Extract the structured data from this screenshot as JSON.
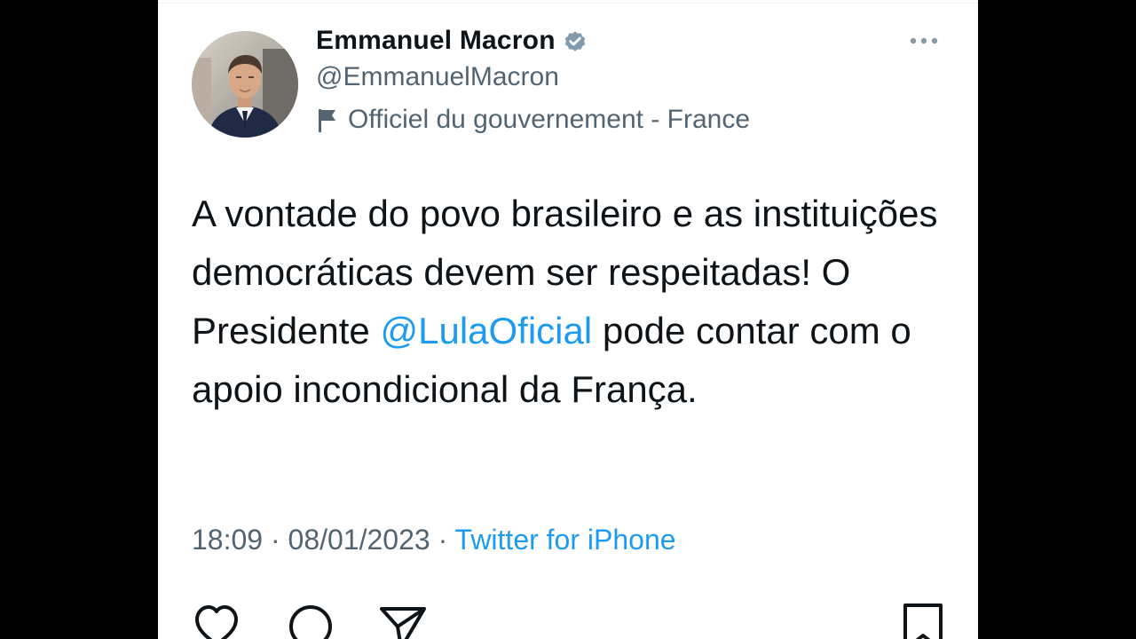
{
  "tweet": {
    "author": {
      "display_name": "Emmanuel Macron",
      "handle": "@EmmanuelMacron",
      "label": "Officiel du gouvernement - France"
    },
    "text": {
      "part1": "A vontade do povo brasileiro e as instituições democráticas devem ser respeitadas! O Presidente ",
      "mention": "@LulaOficial",
      "part2": " pode contar com o apoio incondicional da França."
    },
    "meta": {
      "time": "18:09",
      "date": "08/01/2023",
      "separator": " · ",
      "source": "Twitter for iPhone"
    }
  },
  "icons": {
    "verified": "verified-badge-icon",
    "label_flag": "flag-icon",
    "more": "more-options-icon",
    "like": "heart-icon",
    "reply": "reply-bubble-icon",
    "share": "share-send-icon",
    "bookmark": "bookmark-icon"
  },
  "colors": {
    "text": "#0f1419",
    "secondary": "#536471",
    "link": "#1d9bf0",
    "background": "#ffffff",
    "frame": "#000000"
  }
}
